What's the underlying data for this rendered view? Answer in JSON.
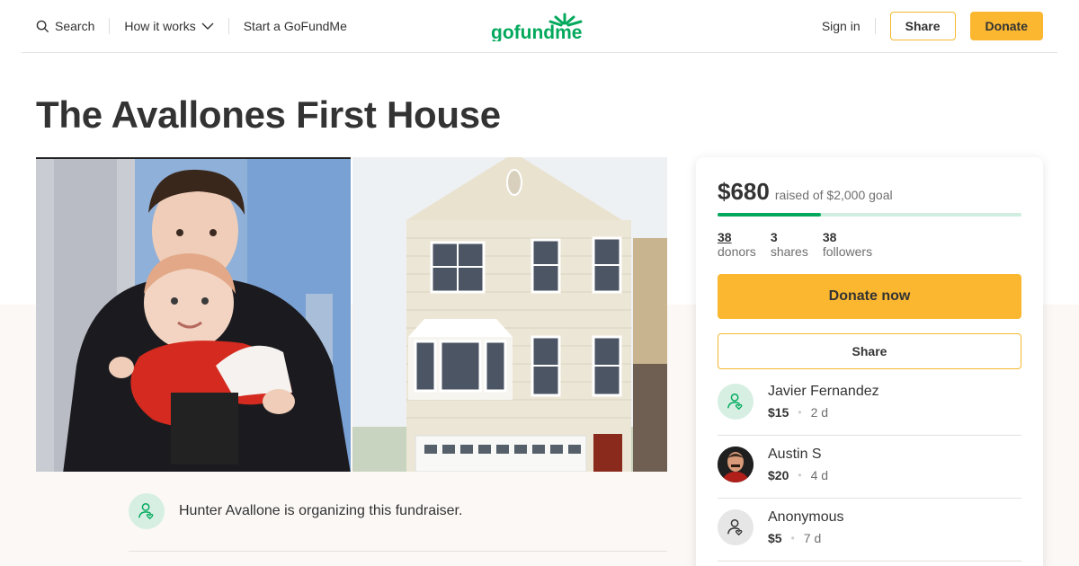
{
  "header": {
    "search_label": "Search",
    "how_it_works_label": "How it works",
    "start_label": "Start a GoFundMe",
    "logo_text": "gofundme",
    "signin_label": "Sign in",
    "share_label": "Share",
    "donate_label": "Donate"
  },
  "campaign": {
    "title": "The Avallones First House",
    "organizer_text": "Hunter Avallone is organizing this fundraiser."
  },
  "donation": {
    "raised": "$680",
    "goal_text": "raised of $2,000 goal",
    "progress_fraction": 0.34,
    "stats": [
      {
        "num": "38",
        "label": "donors"
      },
      {
        "num": "3",
        "label": "shares"
      },
      {
        "num": "38",
        "label": "followers"
      }
    ],
    "donate_now_label": "Donate now",
    "share_label": "Share"
  },
  "donors": [
    {
      "name": "Javier Fernandez",
      "amount": "$15",
      "time": "2 d",
      "avatar": "person-icon"
    },
    {
      "name": "Austin S",
      "amount": "$20",
      "time": "4 d",
      "avatar": "photo"
    },
    {
      "name": "Anonymous",
      "amount": "$5",
      "time": "7 d",
      "avatar": "person-icon"
    }
  ],
  "colors": {
    "brand_green": "#02a95c",
    "accent_yellow": "#fbb730",
    "progress_track": "#cfeee0"
  }
}
